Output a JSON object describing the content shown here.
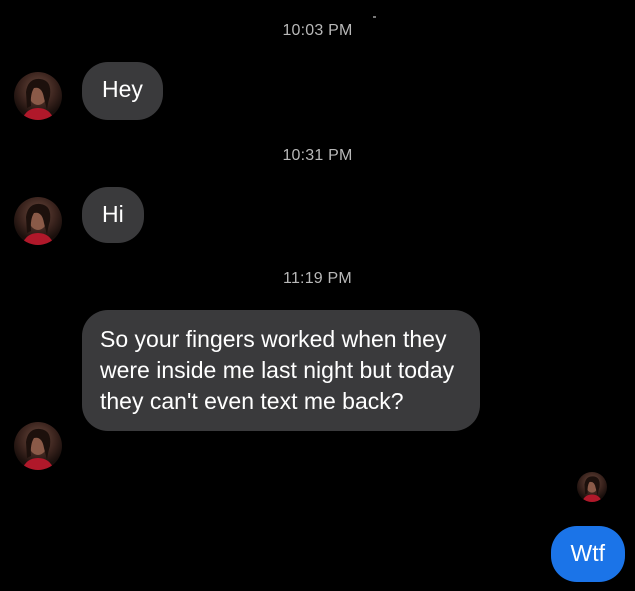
{
  "conversation": {
    "messages": [
      {
        "timestamp": "10:03 PM",
        "text": "Hey",
        "sender": "them"
      },
      {
        "timestamp": "10:31 PM",
        "text": "Hi",
        "sender": "them"
      },
      {
        "timestamp": "11:19 PM",
        "text": "So your fingers worked when they were inside me last night but today they can't even text me back?",
        "sender": "them"
      },
      {
        "text": "Wtf",
        "sender": "me"
      }
    ]
  },
  "colors": {
    "background": "#000000",
    "incoming_bubble": "#3a3a3c",
    "outgoing_bubble": "#1b74e8",
    "timestamp_text": "#b8b8b8"
  },
  "icons": {
    "contact_avatar": "contact-avatar-photo",
    "read_receipt": "read-receipt-avatar"
  }
}
